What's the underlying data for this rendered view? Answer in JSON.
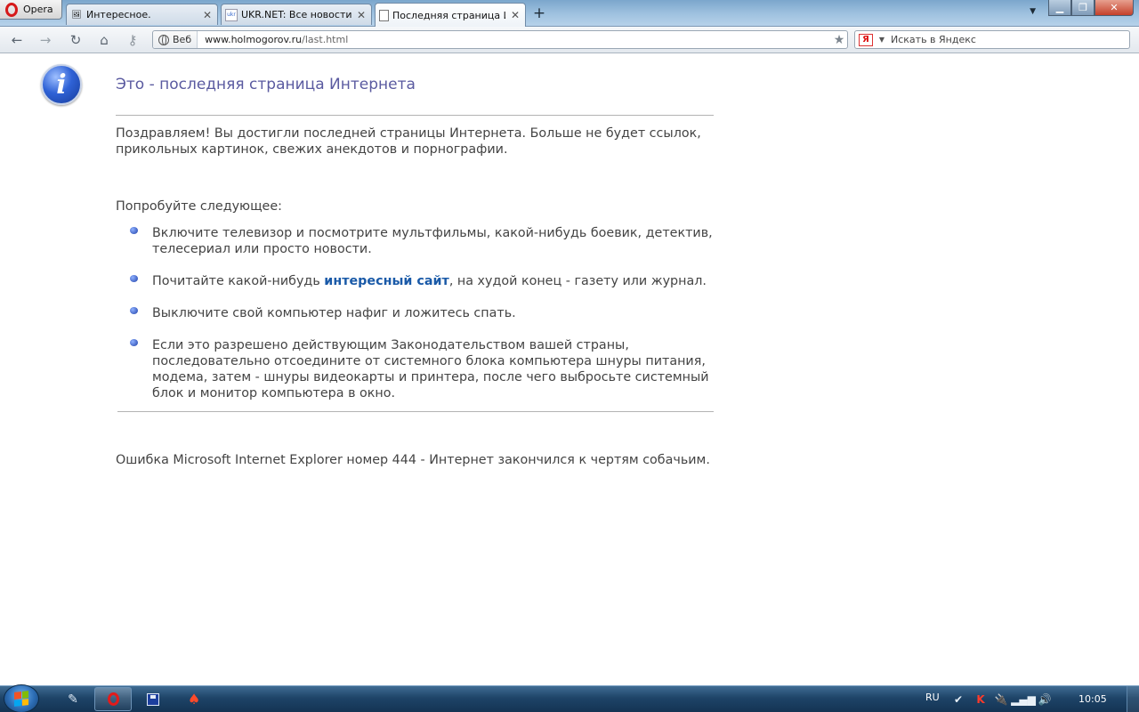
{
  "browser": {
    "menu_label": "Opera",
    "tabs": [
      {
        "title": "Интересное.",
        "active": false
      },
      {
        "title": "UKR.NET: Все новости У...",
        "active": false
      },
      {
        "title": "Последняя страница И...",
        "active": true
      }
    ],
    "toolbar": {
      "web_badge": "Веб",
      "url_domain": "www.holmogorov.ru",
      "url_path": "/last.html",
      "search_placeholder": "Искать в Яндекс",
      "search_engine_icon": "Я"
    }
  },
  "page": {
    "title": "Это - последняя страница Интернета",
    "intro": "Поздравляем! Вы достигли последней страницы Интернета. Больше не будет ссылок, прикольных картинок, свежих анекдотов и порнографии.",
    "try_heading": "Попробуйте следующее:",
    "tips": [
      {
        "text": "Включите телевизор и посмотрите мультфильмы, какой-нибудь боевик, детектив, телесериал или просто новости."
      },
      {
        "before": "Почитайте какой-нибудь ",
        "link": "интересный сайт",
        "after": ", на худой конец - газету или журнал."
      },
      {
        "text": "Выключите свой компьютер нафиг и ложитесь спать."
      },
      {
        "text": "Если это разрешено действующим Законодательством вашей страны, последовательно отсоедините от системного блока компьютера шнуры питания, модема, затем - шнуры видеокарты и принтера, после чего выбросьте системный блок и монитор компьютера в окно."
      }
    ],
    "error_message": "Ошибка Microsoft Internet Explorer номер 444 - Интернет закончился к чертям собачьим."
  },
  "taskbar": {
    "language": "RU",
    "clock": "10:05"
  },
  "icons": {
    "info": "info-icon",
    "back": "back-arrow-icon",
    "forward": "forward-arrow-icon",
    "reload": "reload-icon",
    "home": "home-icon",
    "key": "key-icon",
    "star": "star-icon"
  },
  "colors": {
    "page_title": "#5a5aa0",
    "link": "#1a5aa8",
    "body_text": "#444444",
    "opera_red": "#d61a1a"
  }
}
